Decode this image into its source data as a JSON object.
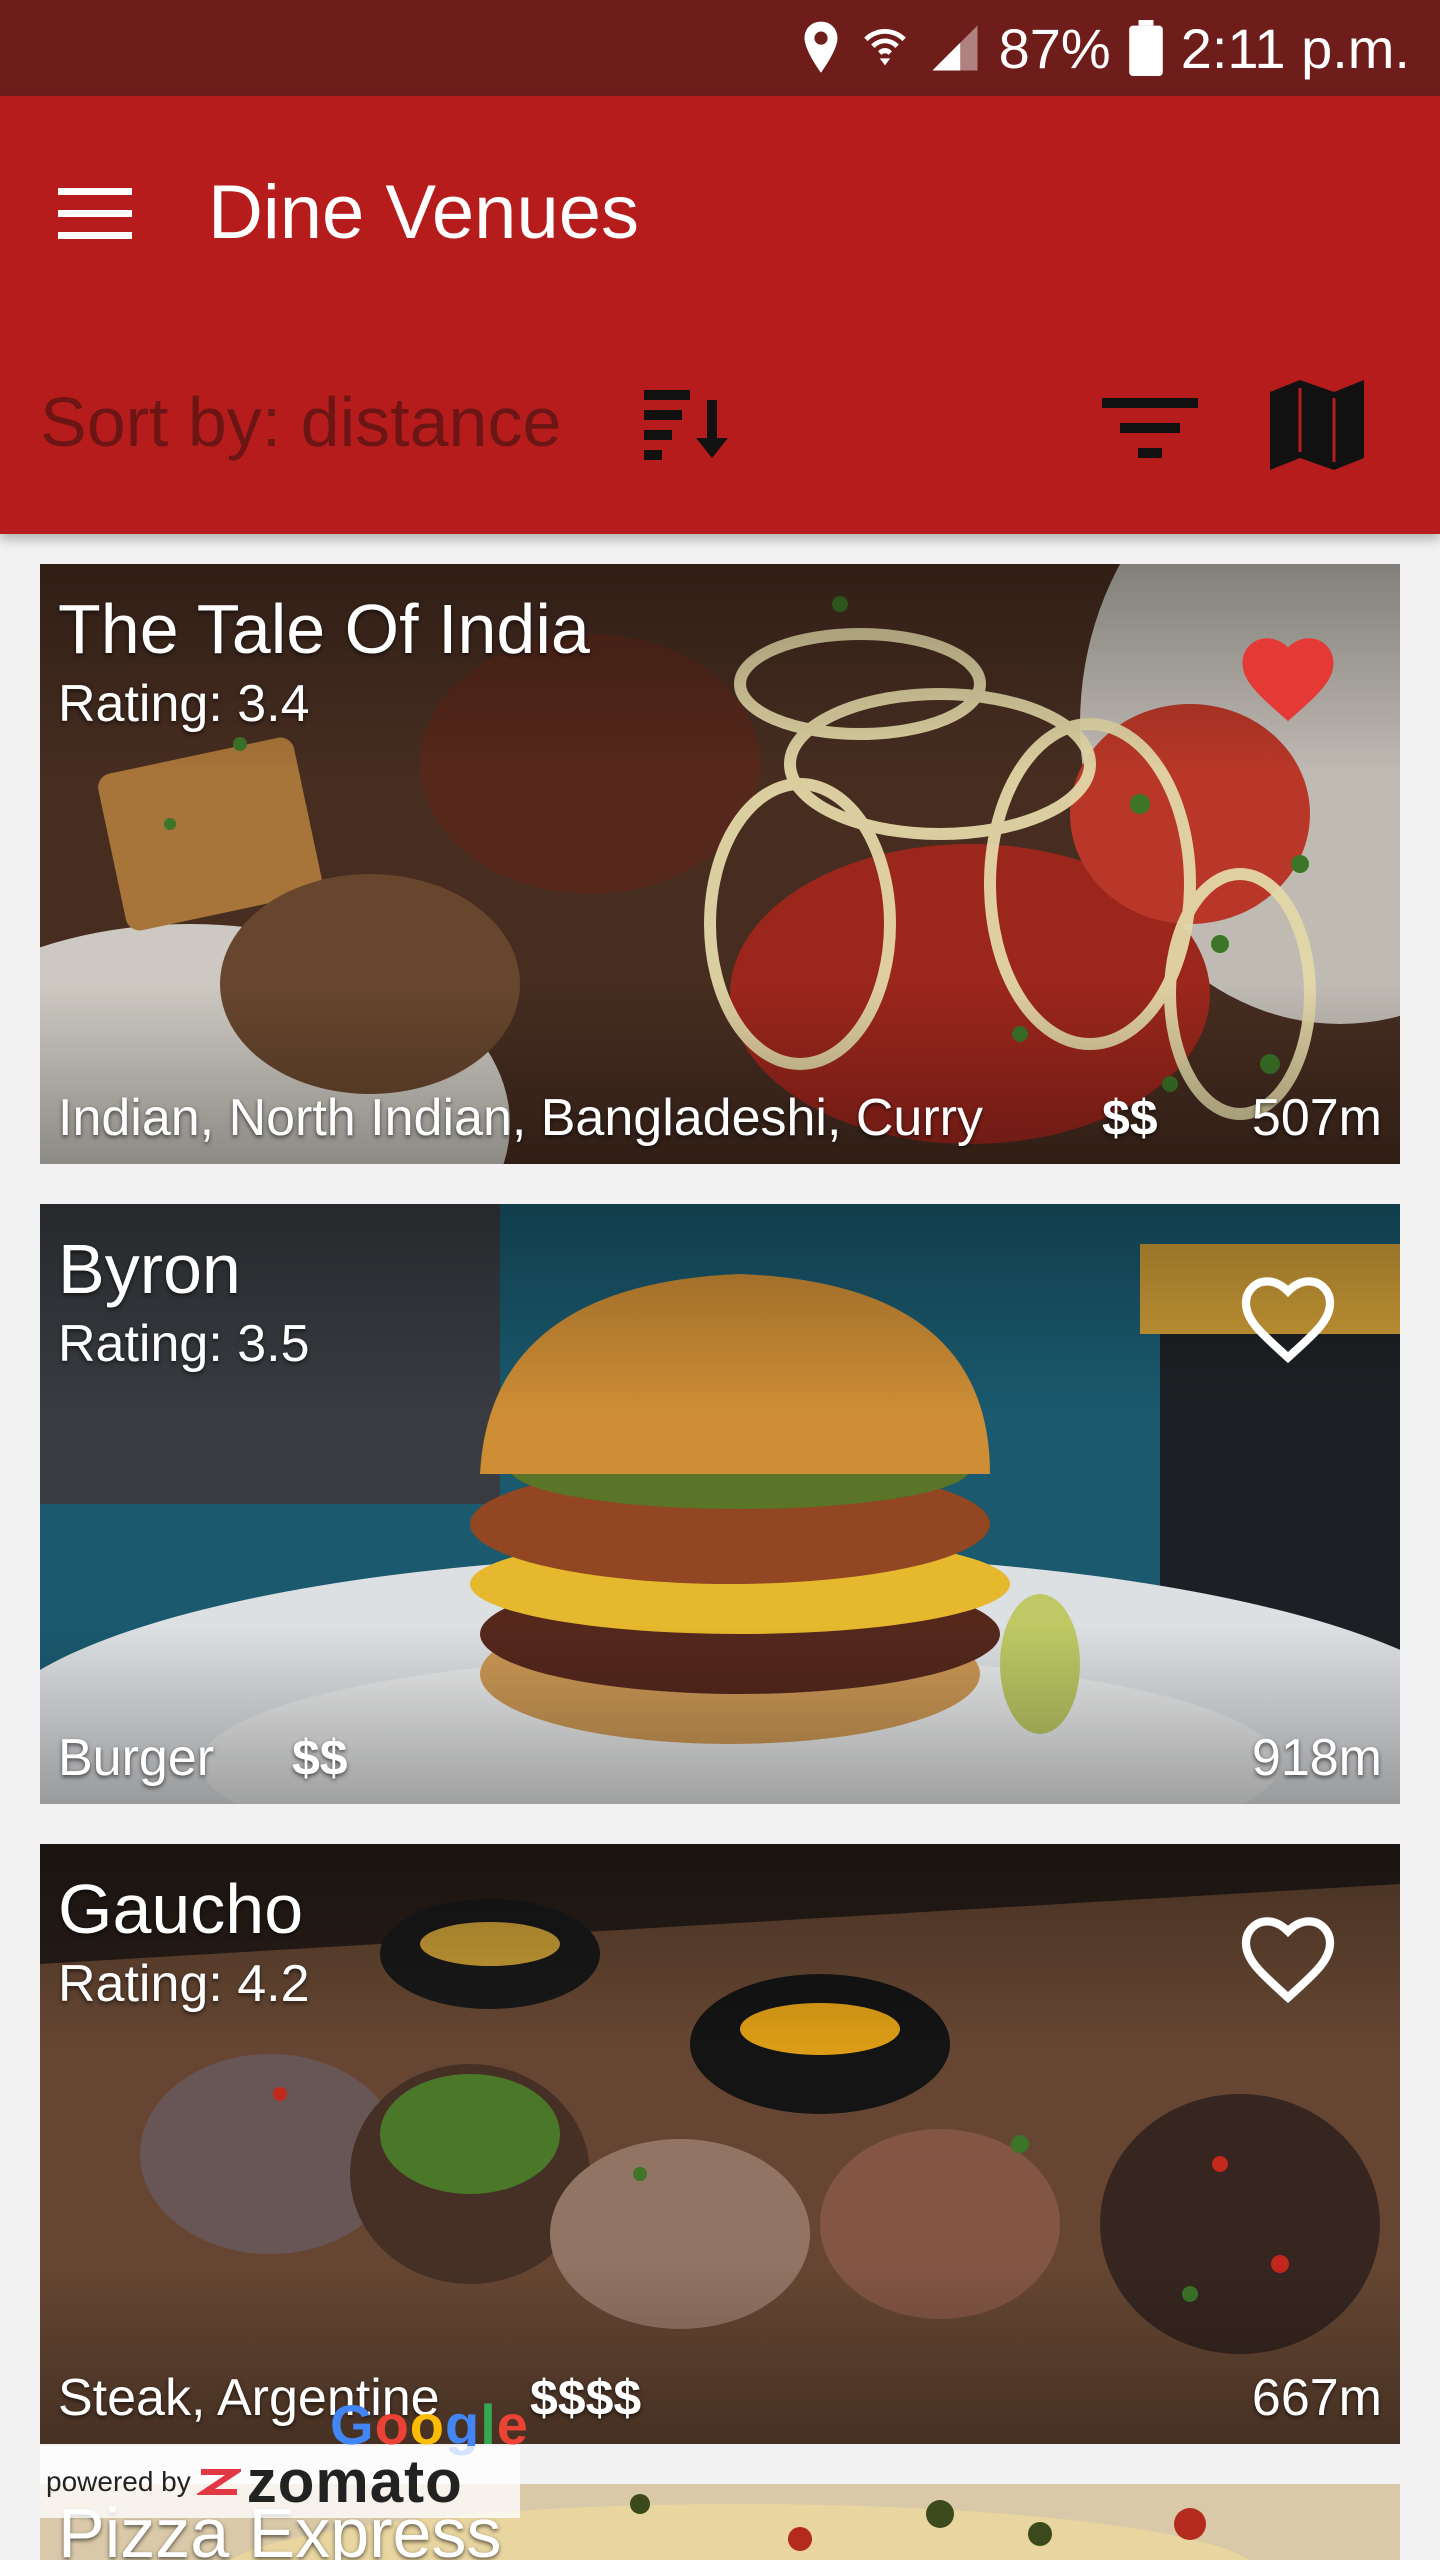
{
  "status_bar": {
    "battery": "87%",
    "time": "2:11 p.m.",
    "icons": [
      "location-icon",
      "wifi-icon",
      "signal-icon",
      "battery-icon"
    ]
  },
  "app_bar": {
    "title": "Dine Venues",
    "sort_label": "Sort by: distance",
    "icons": [
      "menu-icon",
      "sort-icon",
      "filter-icon",
      "map-icon"
    ]
  },
  "venues": [
    {
      "name": "The Tale Of India",
      "rating": "Rating: 3.4",
      "cuisine": "Indian, North Indian, Bangladeshi, Curry",
      "price": "$$",
      "distance": "507m",
      "favorite": true
    },
    {
      "name": "Byron",
      "rating": "Rating: 3.5",
      "cuisine": "Burger",
      "price": "$$",
      "distance": "918m",
      "favorite": false
    },
    {
      "name": "Gaucho",
      "rating": "Rating: 4.2",
      "cuisine": "Steak, Argentine",
      "price": "$$$$",
      "distance": "667m",
      "favorite": false
    },
    {
      "name": "Pizza Express",
      "rating": "",
      "cuisine": "",
      "price": "",
      "distance": "",
      "favorite": false
    }
  ],
  "attribution": {
    "google": "Google",
    "powered_by": "powered by",
    "brand": "zomato"
  },
  "colors": {
    "status_bar": "#6e1d1b",
    "app_bar": "#b71c1c",
    "sort_label": "#6b1615",
    "favorite_active": "#e53935",
    "background": "#f2f2f2"
  }
}
